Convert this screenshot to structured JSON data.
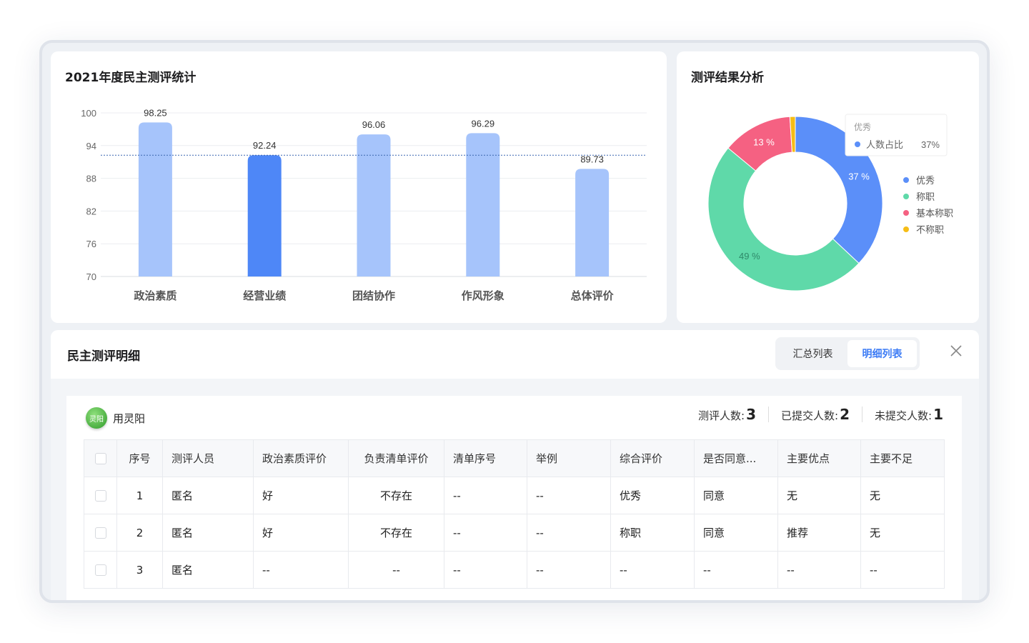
{
  "bar_panel": {
    "title": "2021年度民主测评统计"
  },
  "pie_panel": {
    "title": "测评结果分析",
    "tooltip": {
      "title": "优秀",
      "label": "人数占比",
      "value": "37%"
    }
  },
  "chart_data": [
    {
      "type": "bar",
      "title": "2021年度民主测评统计",
      "categories": [
        "政治素质",
        "经营业绩",
        "团结协作",
        "作风形象",
        "总体评价"
      ],
      "values": [
        98.25,
        92.24,
        96.06,
        96.29,
        89.73
      ],
      "value_labels": [
        "98.25",
        "92.24",
        "96.06",
        "96.29",
        "89.73"
      ],
      "highlight_index": 1,
      "ylim": [
        70,
        100
      ],
      "yticks": [
        "70",
        "76",
        "82",
        "88",
        "94",
        "100"
      ],
      "reference_line": 92.24,
      "colors": {
        "bar": "#a6c4fb",
        "highlight": "#4e87f7",
        "reference": "#3a66b0"
      },
      "grid": true
    },
    {
      "type": "pie",
      "title": "测评结果分析",
      "labels": [
        "优秀",
        "称职",
        "基本称职",
        "不称职"
      ],
      "values": [
        37,
        49,
        13,
        1
      ],
      "slice_labels": [
        "37 %",
        "49 %",
        "13 %",
        ""
      ],
      "colors": [
        "#5b8ff9",
        "#5fd9a9",
        "#f56182",
        "#f6bd16"
      ],
      "legend": "right"
    }
  ],
  "detail": {
    "title": "民主测评明细",
    "tabs": [
      {
        "label": "汇总列表",
        "active": false
      },
      {
        "label": "明细列表",
        "active": true
      }
    ],
    "person": {
      "avatar_text": "灵阳",
      "name": "用灵阳"
    },
    "stats": [
      {
        "label": "测评人数:",
        "value": "3"
      },
      {
        "label": "已提交人数:",
        "value": "2"
      },
      {
        "label": "未提交人数:",
        "value": "1"
      }
    ],
    "columns": [
      "序号",
      "测评人员",
      "政治素质评价",
      "负责清单评价",
      "清单序号",
      "举例",
      "综合评价",
      "是否同意...",
      "主要优点",
      "主要不足"
    ],
    "rows": [
      [
        "1",
        "匿名",
        "好",
        "不存在",
        "--",
        "--",
        "优秀",
        "同意",
        "无",
        "无"
      ],
      [
        "2",
        "匿名",
        "好",
        "不存在",
        "--",
        "--",
        "称职",
        "同意",
        "推荐",
        "无"
      ],
      [
        "3",
        "匿名",
        "--",
        "--",
        "--",
        "--",
        "--",
        "--",
        "--",
        "--"
      ]
    ]
  }
}
